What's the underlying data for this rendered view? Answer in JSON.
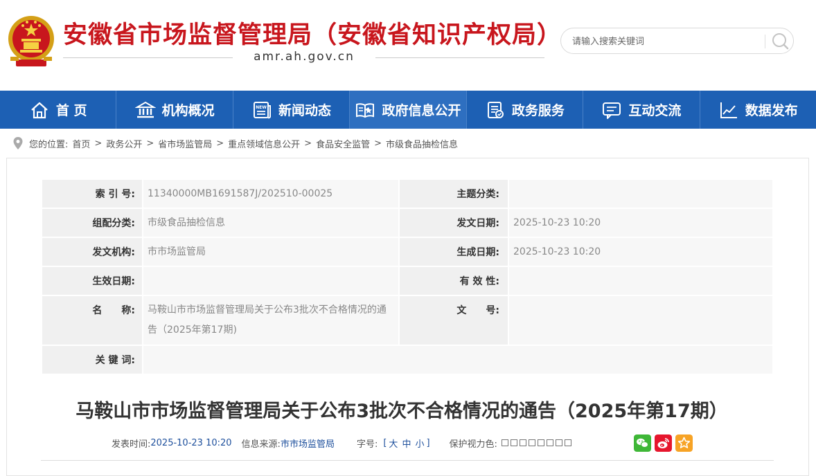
{
  "header": {
    "site_title": "安徽省市场监督管理局（安徽省知识产权局）",
    "domain": "amr.ah.gov.cn",
    "brand_color": "#c8161d",
    "emblem_icon": "national-emblem-icon"
  },
  "search": {
    "placeholder": "请输入搜索关键词",
    "icon": "search-icon"
  },
  "nav": {
    "items": [
      {
        "label": "首 页",
        "icon": "home-icon"
      },
      {
        "label": "机构概况",
        "icon": "institution-icon"
      },
      {
        "label": "新闻动态",
        "icon": "news-icon"
      },
      {
        "label": "政府信息公开",
        "icon": "open-book-icon"
      },
      {
        "label": "政务服务",
        "icon": "service-document-icon"
      },
      {
        "label": "互动交流",
        "icon": "chat-icon"
      },
      {
        "label": "数据发布",
        "icon": "line-chart-icon"
      }
    ],
    "active_index": 3,
    "bg_color": "#1d60b4"
  },
  "breadcrumb": {
    "prefix": "您的位置:",
    "items": [
      "首页",
      "政务公开",
      "省市场监管局",
      "重点领域信息公开",
      "食品安全监管",
      "市级食品抽检信息"
    ],
    "separator": ">"
  },
  "meta": {
    "index_no_label": "索 引 号:",
    "index_no": "11340000MB1691587J/202510-00025",
    "topic_label": "主题分类:",
    "topic": "",
    "group_label": "组配分类:",
    "group": "市级食品抽检信息",
    "issue_date_label": "发文日期:",
    "issue_date": "2025-10-23 10:20",
    "org_label": "发文机构:",
    "org": "市市场监管局",
    "gen_date_label": "生成日期:",
    "gen_date": "2025-10-23 10:20",
    "eff_date_label": "生效日期:",
    "eff_date": "",
    "validity_label": "有 效 性:",
    "validity": "",
    "name_label": "名　　称:",
    "name": "马鞍山市市场监督管理局关于公布3批次不合格情况的通告（2025年第17期)",
    "doc_no_label": "文　　号:",
    "doc_no": "",
    "keywords_label": "关 键 词:",
    "keywords": ""
  },
  "article": {
    "title": "马鞍山市市场监督管理局关于公布3批次不合格情况的通告（2025年第17期）",
    "publish_time_label": "发表时间:",
    "publish_time": "2025-10-23 10:20",
    "source_label": "信息来源:",
    "source": "市市场监管局",
    "font_size_label": "字号:",
    "font_size_open": "[",
    "font_size_options": [
      "大",
      "中",
      "小"
    ],
    "font_size_close": "]",
    "eye_color_label": "保护视力色:",
    "eye_colors_count": 8,
    "share": [
      {
        "icon": "wechat-icon",
        "color": "#3fb737"
      },
      {
        "icon": "weibo-icon",
        "color": "#e6162d"
      },
      {
        "icon": "favorite-star-icon",
        "color": "#f7a325"
      }
    ]
  }
}
